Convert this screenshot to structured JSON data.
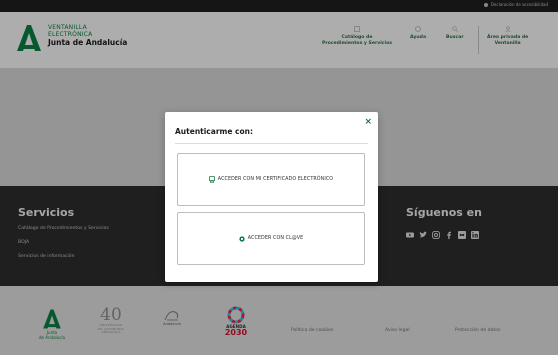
{
  "topbar": {
    "accessibility_label": "Declaración de accesibilidad"
  },
  "header": {
    "logo_line1": "VENTANILLA",
    "logo_line2": "ELECTRÓNICA",
    "logo_line3": "Junta de Andalucía",
    "nav": [
      {
        "line1": "Catálogo de",
        "line2": "Procedimientos y Servicios"
      },
      {
        "line1": "Ayuda",
        "line2": ""
      },
      {
        "line1": "Buscar",
        "line2": ""
      },
      {
        "line1": "Área privada de",
        "line2": "Ventanilla"
      }
    ]
  },
  "footer": {
    "servicios_title": "Servicios",
    "servicios_links": [
      "Catálogo de Procedimientos y Servicios",
      "BOJA",
      "Servicios de información"
    ],
    "siguenos_title": "Síguenos en",
    "bottom_links": [
      "Política de cookies",
      "Aviso legal",
      "Protección de datos"
    ],
    "junta_label_line1": "Junta",
    "junta_label_line2": "de Andalucía",
    "anniv_number": "40",
    "anniv_text": "ANIVERSARIO\nDE AUTONOMÍA\nANDALUCÍA",
    "andalucia_text": "Andalucía",
    "agenda_line1": "AGENDA",
    "agenda_line2": "2030"
  },
  "modal": {
    "title": "Autenticarme con:",
    "close": "×",
    "option_certificate": "ACCEDER CON MI CERTIFICADO ELECTRÓNICO",
    "option_clave": "ACCEDER CON CL@VE"
  },
  "colors": {
    "brand_green": "#0b7a3e",
    "dark_footer": "#2b2b2b"
  }
}
